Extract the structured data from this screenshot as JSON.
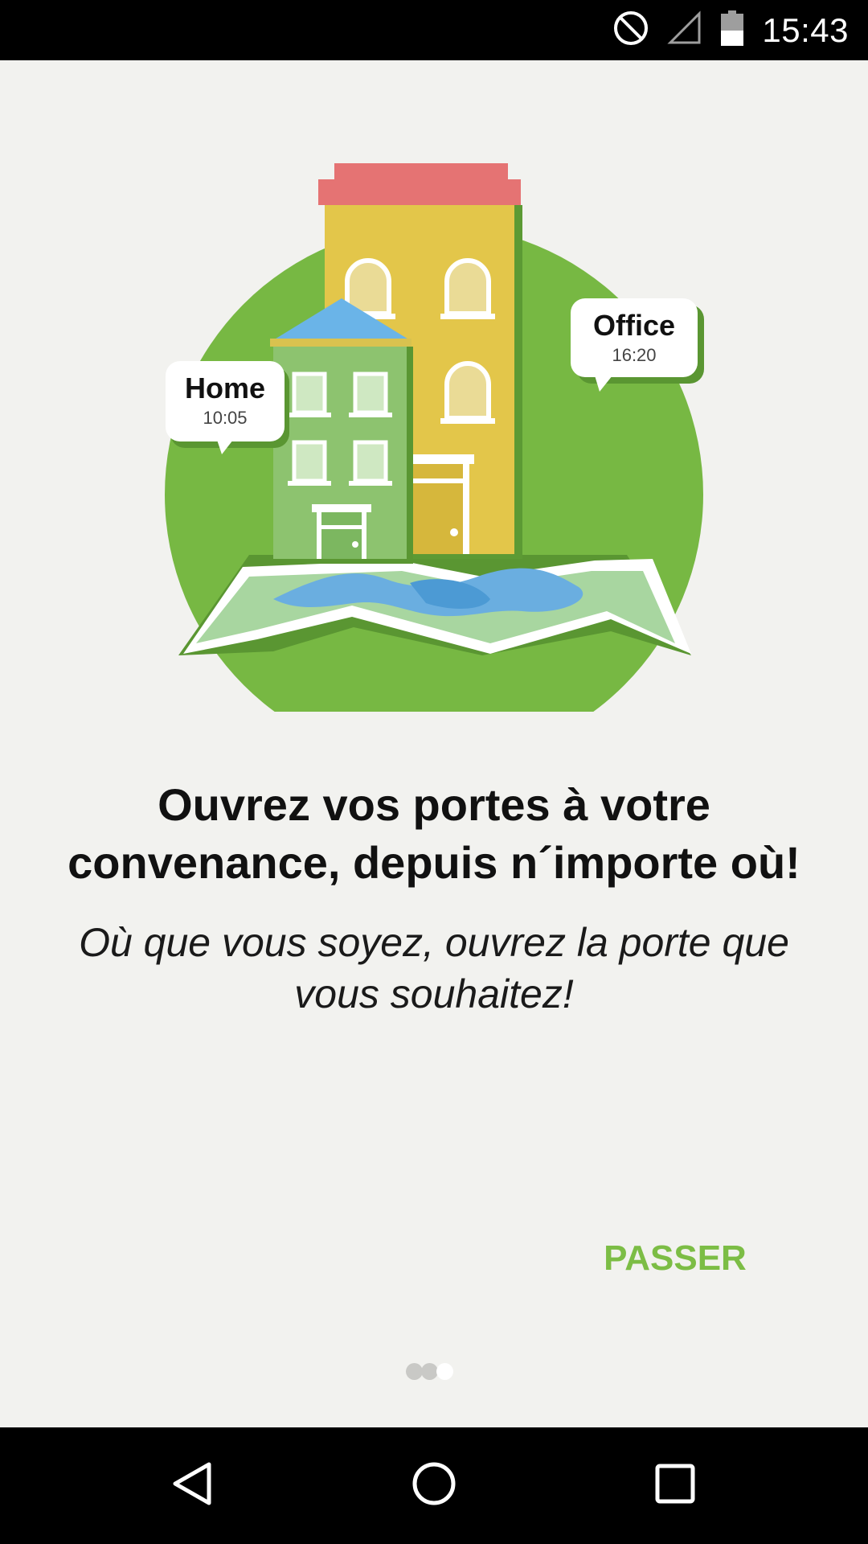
{
  "status_bar": {
    "time": "15:43",
    "icons": [
      "do-not-disturb-icon",
      "signal-icon",
      "battery-icon"
    ]
  },
  "illustration": {
    "home_label": "Home",
    "home_time": "10:05",
    "office_label": "Office",
    "office_time": "16:20"
  },
  "onboarding": {
    "title": "Ouvrez vos portes à votre convenance, depuis n´importe où!",
    "subtitle": "Où que vous soyez, ouvrez la porte que vous souhaitez!",
    "skip_label": "PASSER",
    "page_count": 3,
    "current_page": 3
  },
  "nav_bar": {
    "icons": [
      "back-icon",
      "home-icon",
      "recents-icon"
    ]
  },
  "colors": {
    "accent": "#7cbd45",
    "circle_green": "#77b843",
    "building_yellow": "#e3c64a",
    "roof_red": "#e57373",
    "house_green": "#8dc36f",
    "roof_blue": "#6ab4e8"
  }
}
